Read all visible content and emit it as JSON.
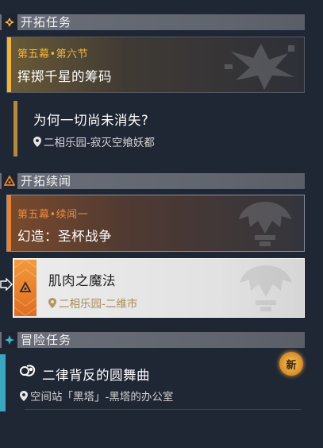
{
  "sections": {
    "trailblaze": {
      "title": "开拓任务"
    },
    "companion": {
      "title": "开拓续闻"
    },
    "adventure": {
      "title": "冒险任务"
    }
  },
  "quests": {
    "q1": {
      "chapter": "第五幕•第六节",
      "name": "挥掷千星的筹码"
    },
    "q2": {
      "name": "为何一切尚未消失?",
      "location": "二相乐园-寂灭空飨妖都"
    },
    "q3": {
      "chapter": "第五幕•续闻一",
      "name": "幻造：圣杯战争"
    },
    "q4": {
      "name": "肌肉之魔法",
      "location": "二相乐园-二维市"
    },
    "q5": {
      "name": "二律背反的圆舞曲",
      "location": "空间站「黑塔」-黑塔的办公室",
      "badge": "新"
    }
  },
  "colors": {
    "accent_gold": "#f2b53a",
    "accent_orange": "#e9822f",
    "accent_cyan": "#39b8d4",
    "selected_bg": "#e4e4e4"
  }
}
